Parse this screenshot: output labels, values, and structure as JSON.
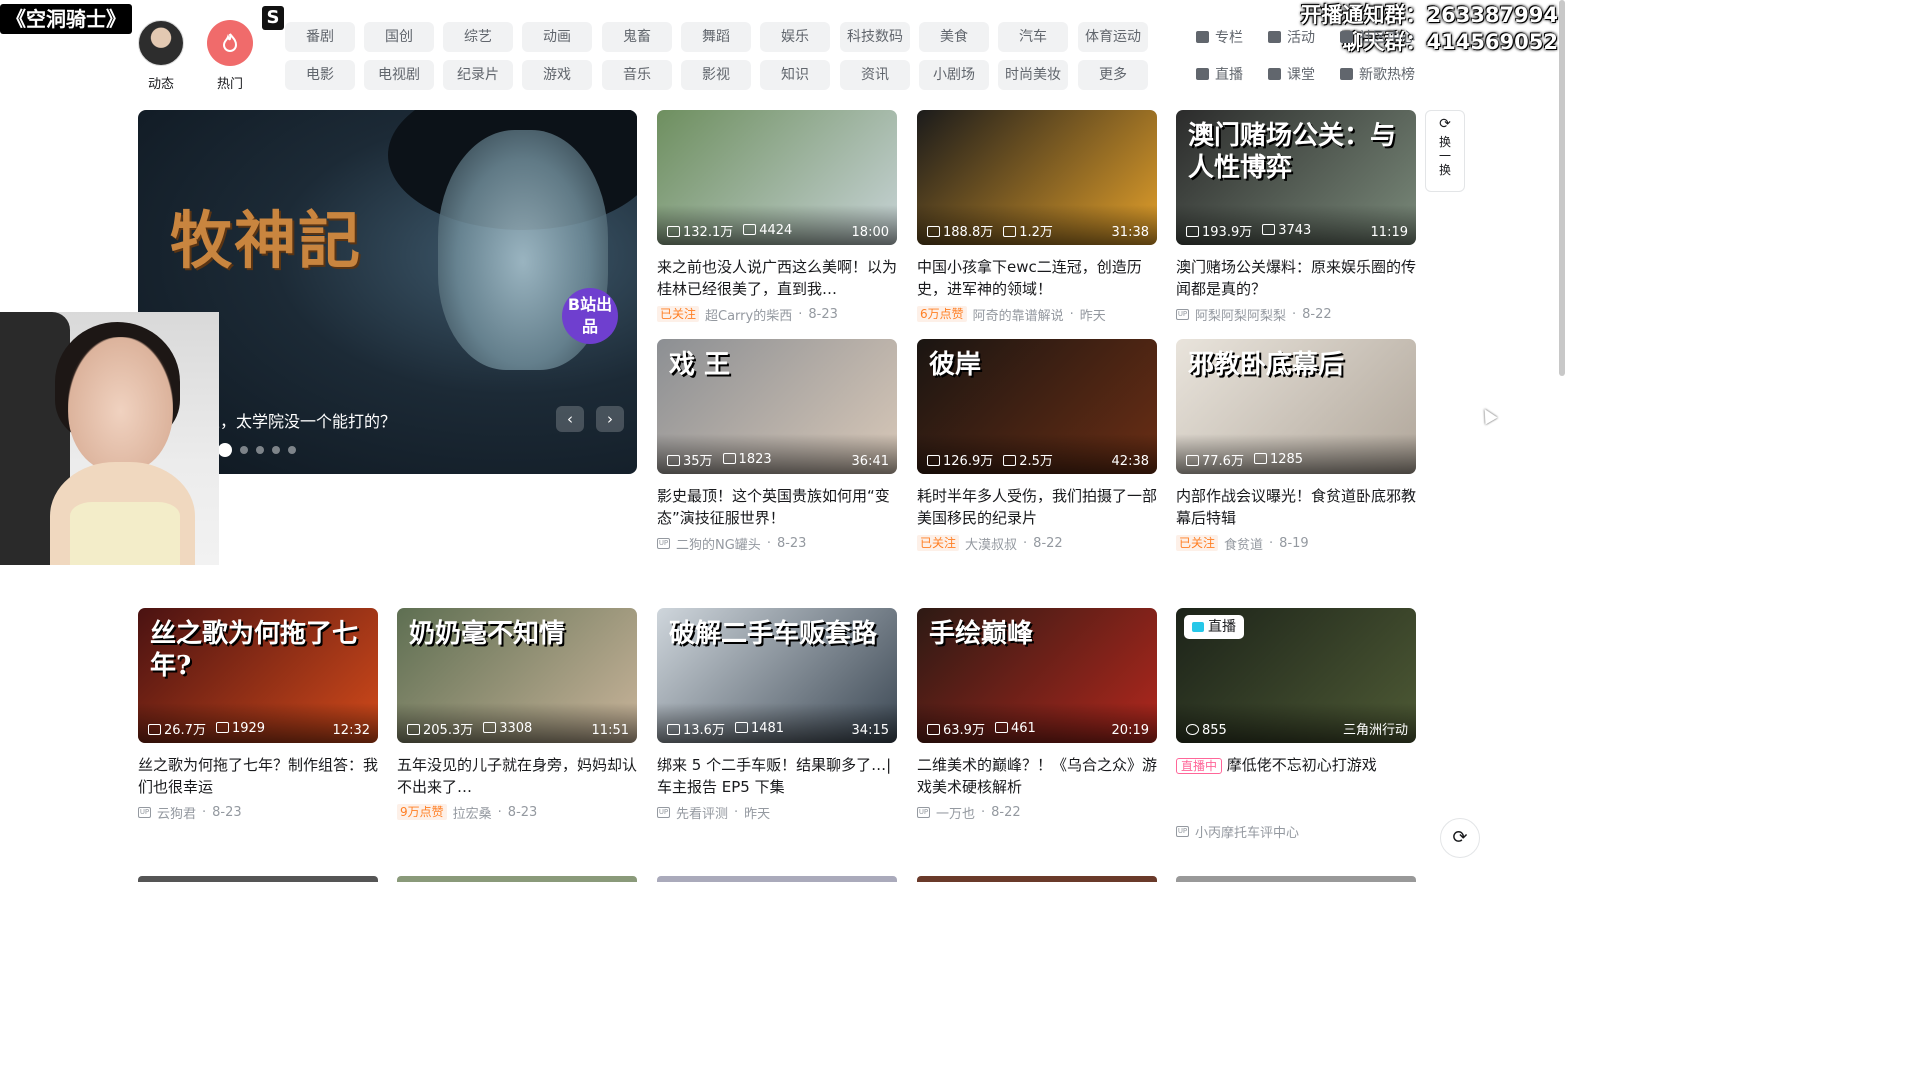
{
  "overlay": {
    "stream_title": "《空洞骑士》",
    "notice_group": "开播通知群：263387994",
    "chat_group": "聊天群：414569052"
  },
  "entries": [
    {
      "label": "动态"
    },
    {
      "label": "热门"
    }
  ],
  "categories_row1": [
    "番剧",
    "国创",
    "综艺",
    "动画",
    "鬼畜",
    "舞蹈",
    "娱乐",
    "科技数码",
    "美食",
    "汽车",
    "体育运动"
  ],
  "categories_row2": [
    "电影",
    "电视剧",
    "纪录片",
    "游戏",
    "音乐",
    "影视",
    "知识",
    "资讯",
    "小剧场",
    "时尚美妆",
    "更多"
  ],
  "tools_row1": [
    "专栏",
    "活动",
    "社区中心"
  ],
  "tools_row2": [
    "直播",
    "课堂",
    "新歌热榜"
  ],
  "carousel": {
    "logo_text": "牧神記",
    "badge": "B站出品",
    "caption": "连败数人，太学院没一个能打的？",
    "prev": "‹",
    "next": "›"
  },
  "refresh": {
    "label": "换一换"
  },
  "cards": [
    {
      "views": "132.1万",
      "danmaku": "4424",
      "duration": "18:00",
      "title": "来之前也没人说广西这么美啊！以为桂林已经很美了，直到我…",
      "tag": "已关注",
      "author": "超Carry的柴西",
      "date": "8-23",
      "color1": "#6e8f5f",
      "color2": "#c7d3d6"
    },
    {
      "views": "188.8万",
      "danmaku": "1.2万",
      "duration": "31:38",
      "title": "中国小孩拿下ewc二连冠，创造历史，进军神的领域！",
      "tag": "6万点赞",
      "author": "阿奇的靠谱解说",
      "date": "昨天",
      "color1": "#1b1b1b",
      "color2": "#e3a02a"
    },
    {
      "views": "193.9万",
      "danmaku": "3743",
      "duration": "11:19",
      "title": "澳门赌场公关爆料：原来娱乐圈的传闻都是真的？",
      "tag": "",
      "author": "阿梨阿梨阿梨梨",
      "date": "8-22",
      "color1": "#2b2b2b",
      "color2": "#7a8a7a",
      "overlay": "澳门赌场公关：与人性博弈"
    },
    {
      "views": "35万",
      "danmaku": "1823",
      "duration": "36:41",
      "title": "影史最顶！这个英国贵族如何用“变态”演技征服世界！",
      "tag": "",
      "author": "二狗的NG罐头",
      "date": "8-23",
      "color1": "#8c8f93",
      "color2": "#d8c8b8",
      "overlay": "戏 王"
    },
    {
      "views": "126.9万",
      "danmaku": "2.5万",
      "duration": "42:38",
      "title": "耗时半年多人受伤，我们拍摄了一部美国移民的纪录片",
      "tag": "已关注",
      "author": "大漠叔叔",
      "date": "8-22",
      "color1": "#1a1512",
      "color2": "#6b2e14",
      "overlay": "彼岸"
    },
    {
      "views": "77.6万",
      "danmaku": "1285",
      "duration": "",
      "title": "内部作战会议曝光！食贫道卧底邪教幕后特辑",
      "tag": "已关注",
      "author": "食贫道",
      "date": "8-19",
      "color1": "#e9e4dc",
      "color2": "#b0a69a",
      "overlay": "邪教卧底幕后"
    },
    {
      "views": "26.7万",
      "danmaku": "1929",
      "duration": "12:32",
      "title": "丝之歌为何拖了七年？制作组答：我们也很幸运",
      "tag": "",
      "author": "云狗君",
      "date": "8-23",
      "color1": "#4a1212",
      "color2": "#d24a1a",
      "overlay": "丝之歌为何拖了七年?"
    },
    {
      "views": "205.3万",
      "danmaku": "3308",
      "duration": "11:51",
      "title": "五年没见的儿子就在身旁，妈妈却认不出来了…",
      "tag": "9万点赞",
      "author": "拉宏桑",
      "date": "8-23",
      "color1": "#5e6f52",
      "color2": "#c9b49a",
      "overlay": "奶奶毫不知情"
    },
    {
      "views": "13.6万",
      "danmaku": "1481",
      "duration": "34:15",
      "title": "绑来 5 个二手车贩！结果聊多了…| 车主报告 EP5 下集",
      "tag": "",
      "author": "先看评测",
      "date": "昨天",
      "color1": "#cfd6dc",
      "color2": "#3b4753",
      "overlay": "破解二手车贩套路"
    },
    {
      "views": "63.9万",
      "danmaku": "461",
      "duration": "20:19",
      "title": "二维美术的巅峰？！《乌合之众》游戏美术硬核解析",
      "tag": "",
      "author": "一万也",
      "date": "8-22",
      "color1": "#2d1a14",
      "color2": "#b2271d",
      "overlay": "手绘巅峰"
    },
    {
      "views": "855",
      "danmaku": "",
      "duration": "三角洲行动",
      "title": "摩低佬不忘初心打游戏",
      "tag": "直播中",
      "author": "小丙摩托车评中心",
      "date": "",
      "color1": "#1c2319",
      "color2": "#4e5a35",
      "live_badge": "直播"
    }
  ],
  "accent": "#fb7299"
}
